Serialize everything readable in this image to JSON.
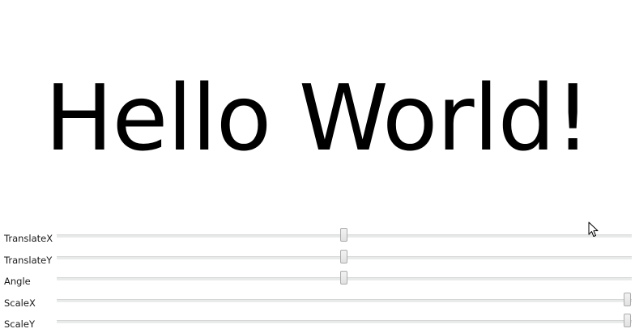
{
  "greeting": "Hello World!",
  "sliders": [
    {
      "label": "TranslateX",
      "value": 0.5
    },
    {
      "label": "TranslateY",
      "value": 0.5
    },
    {
      "label": "Angle",
      "value": 0.5
    },
    {
      "label": "ScaleX",
      "value": 1.0
    },
    {
      "label": "ScaleY",
      "value": 1.0
    }
  ],
  "icons": {
    "pointer": "mouse-pointer-icon"
  }
}
